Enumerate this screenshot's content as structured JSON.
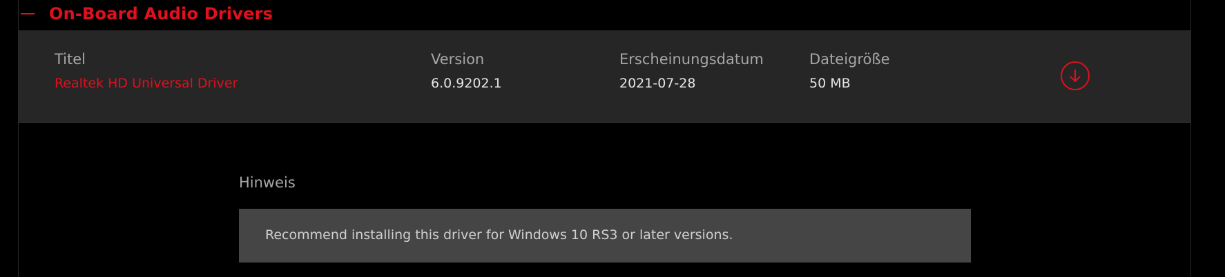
{
  "section": {
    "title": "On-Board Audio Drivers",
    "collapse_icon": "minus-icon"
  },
  "driver": {
    "columns": {
      "title_label": "Titel",
      "version_label": "Version",
      "date_label": "Erscheinungsdatum",
      "size_label": "Dateigröße"
    },
    "title": "Realtek HD Universal Driver",
    "version": "6.0.9202.1",
    "release_date": "2021-07-28",
    "file_size": "50 MB",
    "download_icon": "download-arrow-icon"
  },
  "notes": {
    "title": "Hinweis",
    "text": "Recommend installing this driver for Windows 10 RS3 or later versions."
  },
  "colors": {
    "accent": "#e0101e",
    "row_background": "#262626",
    "notes_background": "#454545",
    "page_background": "#000000"
  }
}
